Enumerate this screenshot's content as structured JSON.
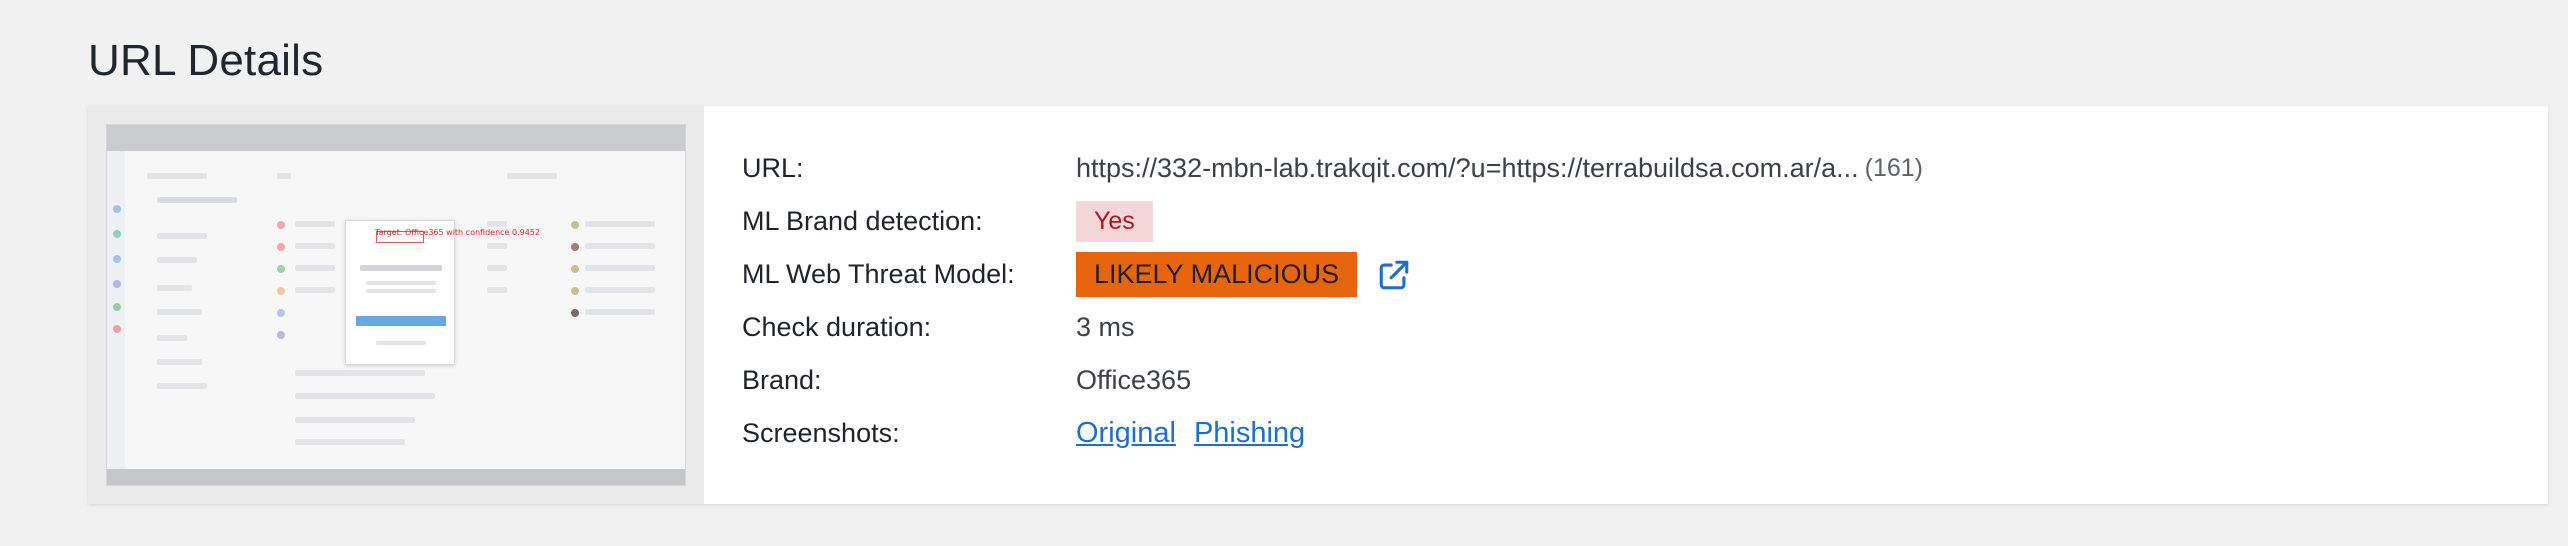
{
  "page": {
    "title": "URL Details"
  },
  "thumbnail": {
    "overlay_text": "Target: Office365 with confidence 0.9452"
  },
  "details": {
    "url": {
      "label": "URL:",
      "value": "https://332-mbn-lab.trakqit.com/?u=https://terrabuildsa.com.ar/a...",
      "length": "(161)"
    },
    "ml_brand_detection": {
      "label": "ML Brand detection:",
      "value": "Yes",
      "color": "#b4141c",
      "bg": "#f6d7d9"
    },
    "ml_web_threat": {
      "label": "ML Web Threat Model:",
      "value": "LIKELY MALICIOUS",
      "bg": "#e8650d",
      "icon": "external-link-icon"
    },
    "check_duration": {
      "label": "Check duration:",
      "value": "3 ms"
    },
    "brand": {
      "label": "Brand:",
      "value": "Office365"
    },
    "screenshots": {
      "label": "Screenshots:",
      "links": [
        "Original",
        "Phishing"
      ]
    }
  },
  "colors": {
    "link": "#1c6fd1",
    "title": "#1e2632"
  }
}
